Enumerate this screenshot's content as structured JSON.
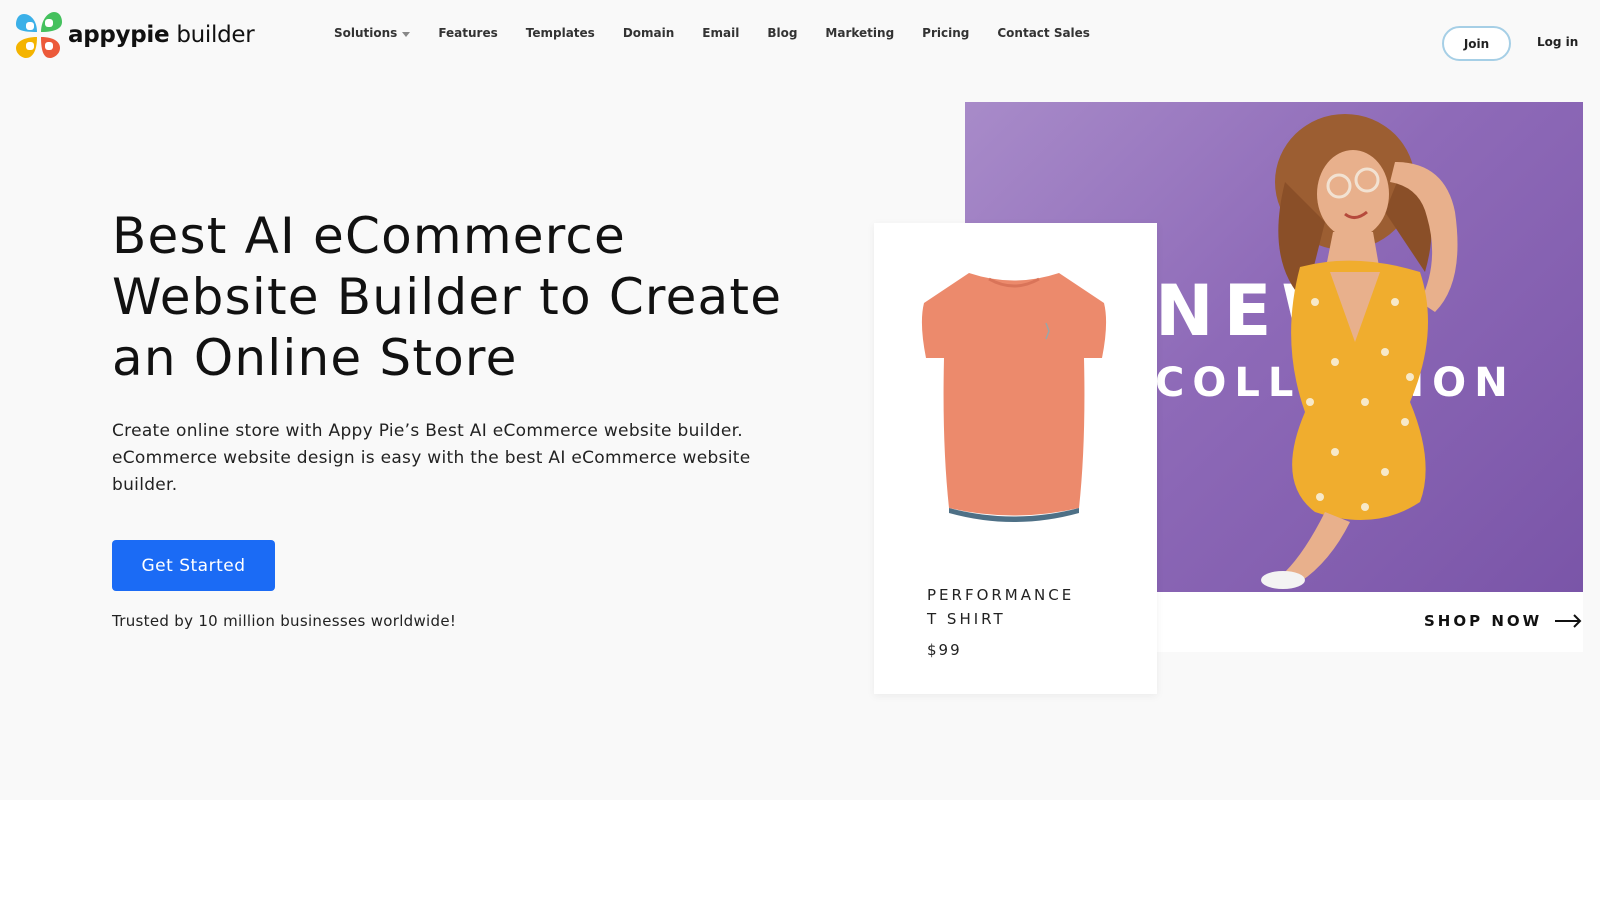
{
  "brand": {
    "name_bold": "appypie",
    "name_rest": "builder",
    "colors": [
      "#3bb0e8",
      "#45c15e",
      "#f4b400",
      "#ec5a3a"
    ]
  },
  "nav": {
    "items": [
      {
        "label": "Solutions",
        "dropdown": true
      },
      {
        "label": "Features"
      },
      {
        "label": "Templates"
      },
      {
        "label": "Domain"
      },
      {
        "label": "Email"
      },
      {
        "label": "Blog"
      },
      {
        "label": "Marketing"
      },
      {
        "label": "Pricing"
      },
      {
        "label": "Contact Sales"
      }
    ],
    "join_label": "Join",
    "login_label": "Log in"
  },
  "hero": {
    "title": "Best AI eCommerce Website Builder to Create an Online Store",
    "description": "Create online store with Appy Pie’s Best AI eCommerce website builder. eCommerce website design is easy with the best AI eCommerce website builder.",
    "cta_label": "Get Started",
    "cta_color": "#1b6bf5",
    "trusted_text": "Trusted by 10 million businesses worldwide!"
  },
  "promo": {
    "headline": "NEW",
    "subheadline": "COLLECTION",
    "shop_now": "SHOP NOW",
    "background_color": "#8e6ab8"
  },
  "product": {
    "name_line1": "PERFORMANCE",
    "name_line2": "T SHIRT",
    "price": "$99",
    "shirt_color": "#ec8a6c"
  }
}
